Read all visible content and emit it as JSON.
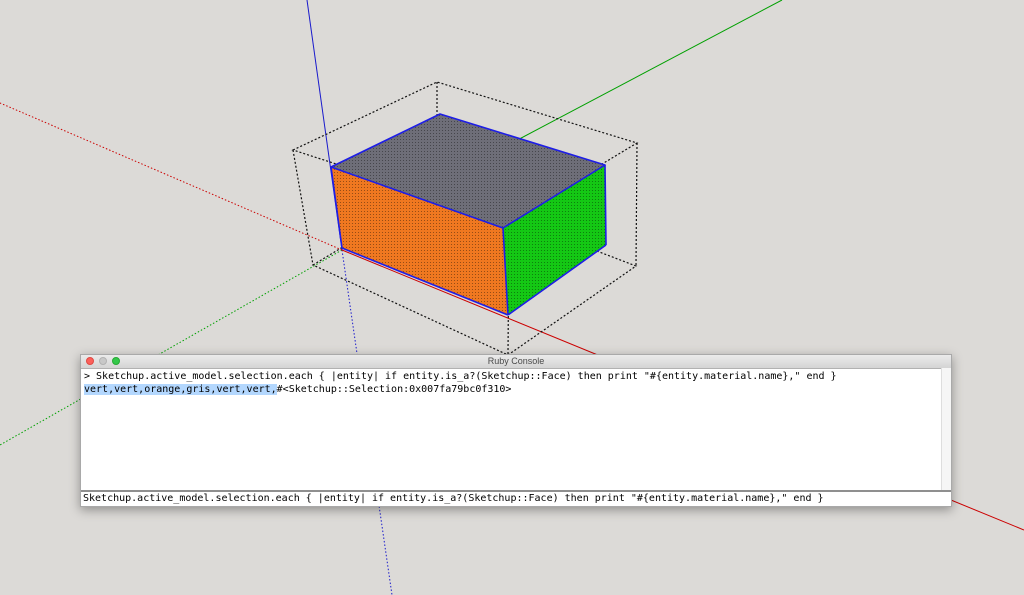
{
  "console": {
    "title": "Ruby Console",
    "output_command": "> Sketchup.active_model.selection.each { |entity| if entity.is_a?(Sketchup::Face) then print \"#{entity.material.name},\" end }",
    "output_result_selected": "vert,vert,orange,gris,vert,vert,",
    "output_result_rest": "#<Sketchup::Selection:0x007fa79bc0f310>",
    "input_value": "Sketchup.active_model.selection.each { |entity| if entity.is_a?(Sketchup::Face) then print \"#{entity.material.name},\" end }",
    "window_buttons": [
      "close",
      "minimize",
      "zoom"
    ]
  },
  "scene": {
    "background_color": "#dcdad7",
    "axis_colors": {
      "red": "#cc0000",
      "green": "#00a000",
      "blue": "#1a1acc"
    },
    "face_materials": [
      "gris",
      "orange",
      "vert"
    ],
    "face_colors": {
      "gris": "#6e6e78",
      "orange": "#f07820",
      "vert": "#14c814"
    },
    "selection_edge_color": "#1e1ee6",
    "bounding_box_style": "dotted"
  }
}
